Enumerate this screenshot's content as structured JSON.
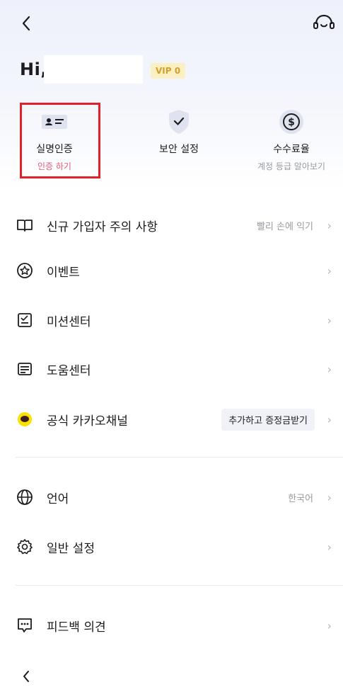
{
  "header": {
    "greeting": "Hi,",
    "vip_badge": "VIP 0"
  },
  "quick_actions": {
    "real_name": {
      "label": "실명인증",
      "sub": "인증 하기"
    },
    "security": {
      "label": "보안 설정"
    },
    "fee": {
      "label": "수수료율",
      "sub": "계정 등급 알아보기"
    }
  },
  "menu": [
    {
      "label": "신규 가입자 주의 사항",
      "right": "빨리 손에 익기",
      "icon": "book-icon"
    },
    {
      "label": "이벤트",
      "icon": "star-badge-icon"
    },
    {
      "label": "미션센터",
      "icon": "checklist-icon"
    },
    {
      "label": "도움센터",
      "icon": "document-icon"
    },
    {
      "label": "공식 카카오채널",
      "right": "추가하고 증정금받기",
      "icon": "kakao-talk-icon"
    },
    {
      "label": "언어",
      "right": "한국어",
      "icon": "globe-icon"
    },
    {
      "label": "일반 설정",
      "icon": "gear-icon"
    },
    {
      "label": "피드백 의견",
      "icon": "feedback-icon"
    }
  ],
  "colors": {
    "highlight": "#e0212b",
    "accent_red": "#e55b77",
    "vip": "#d4a02a",
    "kakao": "#fae100"
  },
  "chevron": "›"
}
